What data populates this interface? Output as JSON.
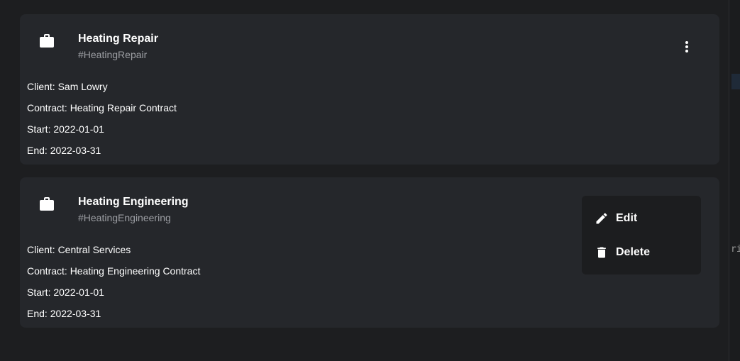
{
  "cards": [
    {
      "title": "Heating Repair",
      "tag": "#HeatingRepair",
      "client": "Client: Sam Lowry",
      "contract": "Contract: Heating Repair Contract",
      "start": "Start: 2022-01-01",
      "end": "End: 2022-03-31",
      "icon": "briefcase-icon"
    },
    {
      "title": "Heating Engineering",
      "tag": "#HeatingEngineering",
      "client": "Client: Central Services",
      "contract": "Contract: Heating Engineering Contract",
      "start": "Start: 2022-01-01",
      "end": "End: 2022-03-31",
      "icon": "briefcase-icon"
    }
  ],
  "menu": {
    "edit_label": "Edit",
    "delete_label": "Delete",
    "edit_icon": "pencil-icon",
    "delete_icon": "trash-icon"
  },
  "side_snippet": "rit",
  "colors": {
    "background": "#1d1e20",
    "card": "#25272b",
    "menu": "#1c1d1f",
    "subtitle": "#9c9ea3"
  }
}
